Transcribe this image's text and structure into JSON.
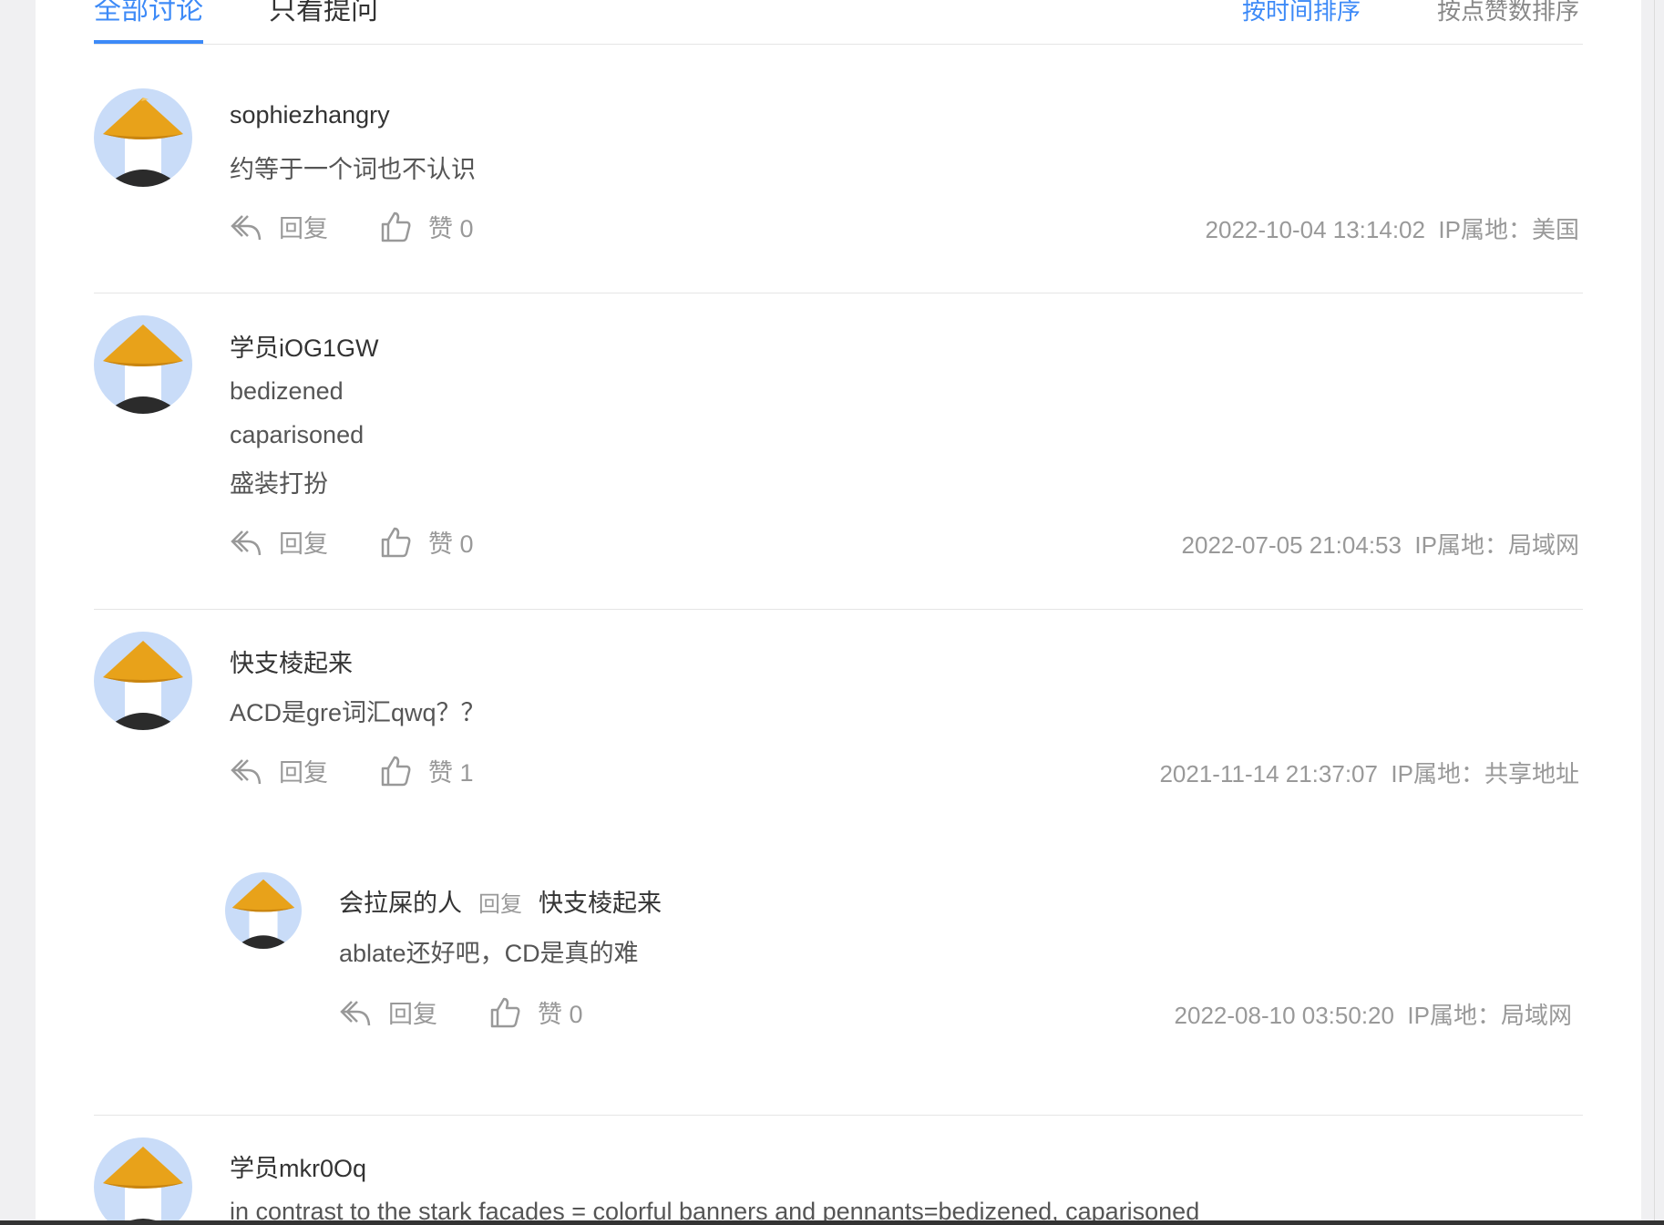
{
  "tabs": {
    "all": "全部讨论",
    "questions": "只看提问",
    "sort_time": "按时间排序",
    "sort_likes": "按点赞数排序"
  },
  "actions": {
    "reply": "回复",
    "like_prefix": "赞"
  },
  "comments": [
    {
      "username": "sophiezhangry",
      "lines": [
        "约等于一个词也不认识"
      ],
      "likes": "赞 0",
      "time": "2022-10-04 13:14:02",
      "ip": "IP属地：美国"
    },
    {
      "username": "学员iOG1GW",
      "lines": [
        "bedizened",
        "caparisoned",
        "盛装打扮"
      ],
      "likes": "赞 0",
      "time": "2022-07-05 21:04:53",
      "ip": "IP属地：局域网"
    },
    {
      "username": "快支棱起来",
      "lines": [
        "ACD是gre词汇qwq？？"
      ],
      "likes": "赞 1",
      "time": "2021-11-14 21:37:07",
      "ip": "IP属地：共享地址",
      "reply": {
        "username": "会拉屎的人",
        "reply_word": "回复",
        "reply_to": "快支棱起来",
        "text": "ablate还好吧，CD是真的难",
        "likes": "赞 0",
        "time": "2022-08-10 03:50:20",
        "ip": "IP属地：局域网"
      }
    },
    {
      "username": "学员mkr0Oq",
      "lines": [
        "in contrast to the stark facades = colorful banners and pennants=bedizened, caparisoned"
      ]
    }
  ],
  "colors": {
    "accent": "#3d8af7",
    "avatar_bg": "#c9dcf8",
    "hat": "#e8a21a"
  },
  "icons": {
    "reply": "reply-arrow-icon",
    "like": "thumbs-up-icon",
    "avatar": "straw-hat-avatar-icon"
  }
}
